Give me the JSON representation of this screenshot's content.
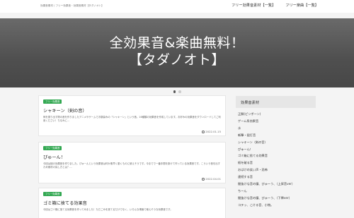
{
  "header": {
    "site_description": "効果音素材 / フリー効果音・効果音素材【タダノオト】",
    "nav": [
      {
        "label": "フリー効果音素材【一覧】"
      },
      {
        "label": "フリー楽曲【一覧】"
      }
    ]
  },
  "hero": {
    "title_line1": "全効果音&楽曲無料！",
    "title_line2": "【タダノオト】"
  },
  "posts": [
    {
      "badge": "フリー効果音",
      "title": "シャキーン（剣の音）",
      "excerpt": "剣を振り出す際の音を作りましたアニメやゲームでお馴染みの「シャキーン」という音。16種類の効果音を作成しています。お好みの効果音をダウンロードしてご利用ください！ちなみに...",
      "date": "2022.01.15"
    },
    {
      "badge": "フリー効果音",
      "title": "ぴゅーん！",
      "excerpt": "今回は謎の効果音を作りました。ぴゅーんという効果音は何か素早く動くものに使えそうです。今までで一番手間を掛けて作っている効果音です。こういう音を出すため素材の探し方とは？…",
      "date": "2022.04.01"
    },
    {
      "badge": "フリー効果音",
      "title": "ゴミ箱に捨てる効果音",
      "excerpt": "今回はゴミ箱に捨てる効果音を作ってみました！ただごみを捨てるだけでなく、いろんな場面で使えそうな効果音です。",
      "date": ""
    }
  ],
  "sidebar": {
    "title": "効果音素材",
    "items": [
      "正解(ピンポーン)",
      "ゲーム系効果音",
      "水",
      "斬撃・殴打音",
      "シャキーン（剣の音）",
      "ぴゅーん！",
      "ゴミ箱に捨てる効果音",
      "紙を破る音",
      "おばけの笑い声・恐怖",
      "連続する音",
      "間抜けな音の鐘、びゅーう、（上昇音ver）",
      "ちーん",
      "間抜けな音の鐘、びゅーう、（下降ver）",
      "コテッ、こける音、小物。"
    ]
  }
}
